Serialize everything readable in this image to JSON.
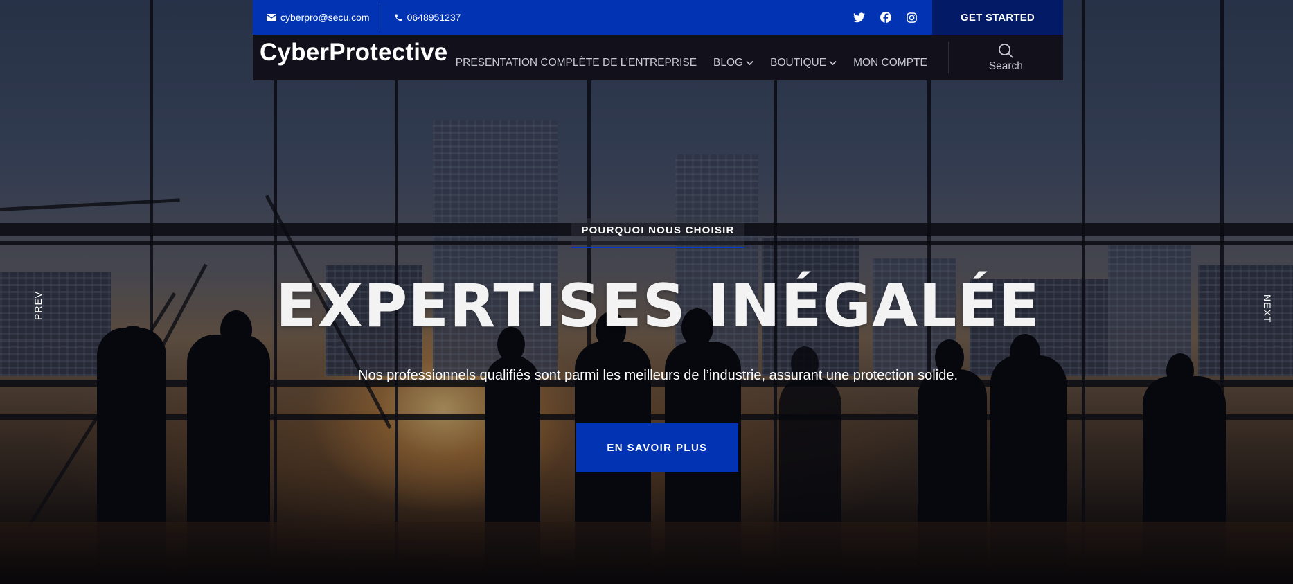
{
  "topbar": {
    "email": "cyberpro@secu.com",
    "phone": "0648951237",
    "socials": [
      "twitter-icon",
      "facebook-icon",
      "instagram-icon"
    ],
    "cta_label": "GET STARTED"
  },
  "nav": {
    "logo": "CyberProtective",
    "items": [
      {
        "label": "PRESENTATION COMPLÈTE DE L’ENTREPRISE",
        "has_dropdown": false
      },
      {
        "label": "BLOG",
        "has_dropdown": true
      },
      {
        "label": "BOUTIQUE",
        "has_dropdown": true
      },
      {
        "label": "MON COMPTE",
        "has_dropdown": false
      }
    ],
    "search_label": "Search"
  },
  "hero": {
    "eyebrow": "POURQUOI NOUS CHOISIR",
    "headline": "EXPERTISES INÉGALÉE",
    "subtitle": "Nos professionnels qualifiés sont parmi les meilleurs de l’industrie, assurant une protection solide.",
    "cta_label": "EN SAVOIR PLUS",
    "prev_label": "PREV",
    "next_label": "NEXT"
  },
  "colors": {
    "accent": "#0233b3",
    "accent_dark": "#031b66",
    "nav_bg": "#12111b"
  }
}
